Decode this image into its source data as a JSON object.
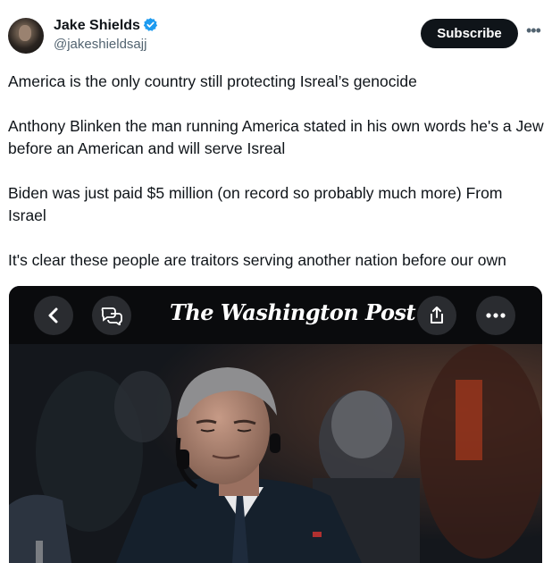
{
  "tweet": {
    "author": {
      "name": "Jake Shields",
      "handle": "@jakeshieldsajj",
      "verified": true,
      "avatar_icon": "profile-photo-avatar"
    },
    "subscribe_label": "Subscribe",
    "more_icon": "more-horizontal-icon",
    "paragraphs": [
      "America is the only country still protecting Isreal’s genocide",
      "Anthony Blinken the man running America stated in his own words he's a Jew before an American and will serve Isreal",
      "Biden was just paid $5 million (on record so probably much more) From Israel",
      "It's clear these people are traitors serving another nation before our own"
    ]
  },
  "embedded_screenshot": {
    "publication_title": "The Washington Post",
    "icons": [
      "back-chevron-icon",
      "comments-icon",
      "share-icon",
      "more-options-icon"
    ],
    "photo_description_icon": "news-photo"
  },
  "colors": {
    "text": "#0f1419",
    "secondary_text": "#536471",
    "verified_blue": "#1d9bf0",
    "button_bg": "#0f1419",
    "media_bar_bg": "#0a0b0d"
  }
}
